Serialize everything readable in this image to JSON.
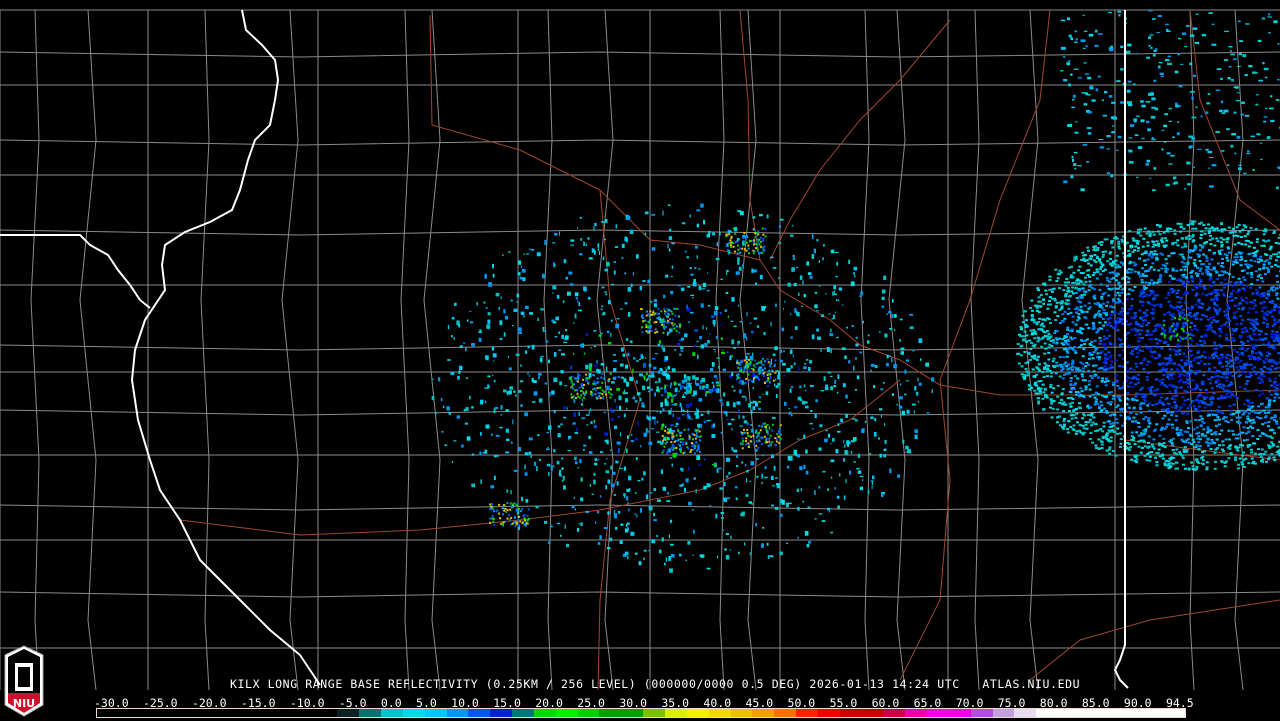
{
  "product_title": "KILX LONG RANGE BASE REFLECTIVITY (0.25KM / 256 LEVEL) (000000/0000 0.5 DEG) 2026-01-13 14:24 UTC   ATLAS.NIU.EDU",
  "logo": {
    "text": "NIU"
  },
  "colorbar": {
    "labels": [
      "-30.0",
      "-25.0",
      "-20.0",
      "-15.0",
      "-10.0",
      "-5.0",
      "0.0",
      "5.0",
      "10.0",
      "15.0",
      "20.0",
      "25.0",
      "30.0",
      "35.0",
      "40.0",
      "45.0",
      "50.0",
      "55.0",
      "60.0",
      "65.0",
      "70.0",
      "75.0",
      "80.0",
      "85.0",
      "90.0",
      "94.5"
    ],
    "min": -30,
    "max": 94.5,
    "segments": [
      {
        "from": -30,
        "to": -2.5,
        "color": "#000000"
      },
      {
        "from": -2.5,
        "to": 0,
        "color": "#0b2222"
      },
      {
        "from": 0,
        "to": 2.5,
        "color": "#0a7272"
      },
      {
        "from": 2.5,
        "to": 5,
        "color": "#00c4c8"
      },
      {
        "from": 5,
        "to": 7.5,
        "color": "#00dce4"
      },
      {
        "from": 7.5,
        "to": 10,
        "color": "#00c8f0"
      },
      {
        "from": 10,
        "to": 12.5,
        "color": "#0098f0"
      },
      {
        "from": 12.5,
        "to": 15,
        "color": "#0058f0"
      },
      {
        "from": 15,
        "to": 17.5,
        "color": "#0020d8"
      },
      {
        "from": 17.5,
        "to": 20,
        "color": "#007878"
      },
      {
        "from": 20,
        "to": 22.5,
        "color": "#00d800"
      },
      {
        "from": 22.5,
        "to": 25,
        "color": "#00f000"
      },
      {
        "from": 25,
        "to": 27.5,
        "color": "#00d000"
      },
      {
        "from": 27.5,
        "to": 32.5,
        "color": "#00a000"
      },
      {
        "from": 32.5,
        "to": 35,
        "color": "#78c000"
      },
      {
        "from": 35,
        "to": 37.5,
        "color": "#d8f000"
      },
      {
        "from": 37.5,
        "to": 40,
        "color": "#f4f000"
      },
      {
        "from": 40,
        "to": 42.5,
        "color": "#f0d800"
      },
      {
        "from": 42.5,
        "to": 45,
        "color": "#e8c000"
      },
      {
        "from": 45,
        "to": 47.5,
        "color": "#f0a000"
      },
      {
        "from": 47.5,
        "to": 50,
        "color": "#f87000"
      },
      {
        "from": 50,
        "to": 52.5,
        "color": "#ff2000"
      },
      {
        "from": 52.5,
        "to": 55,
        "color": "#f00000"
      },
      {
        "from": 55,
        "to": 60,
        "color": "#c80000"
      },
      {
        "from": 60,
        "to": 62.5,
        "color": "#c80048"
      },
      {
        "from": 62.5,
        "to": 65,
        "color": "#e800a8"
      },
      {
        "from": 65,
        "to": 70,
        "color": "#f000e8"
      },
      {
        "from": 70,
        "to": 72.5,
        "color": "#b050d8"
      },
      {
        "from": 72.5,
        "to": 75,
        "color": "#c0a0e0"
      },
      {
        "from": 75,
        "to": 77.5,
        "color": "#e8ddf0"
      },
      {
        "from": 77.5,
        "to": 94.5,
        "color": "#ffffff"
      }
    ]
  },
  "colors": {
    "state_border": "#ffffff",
    "county_border": "#8a8a8a",
    "highway": "#a0482a"
  }
}
